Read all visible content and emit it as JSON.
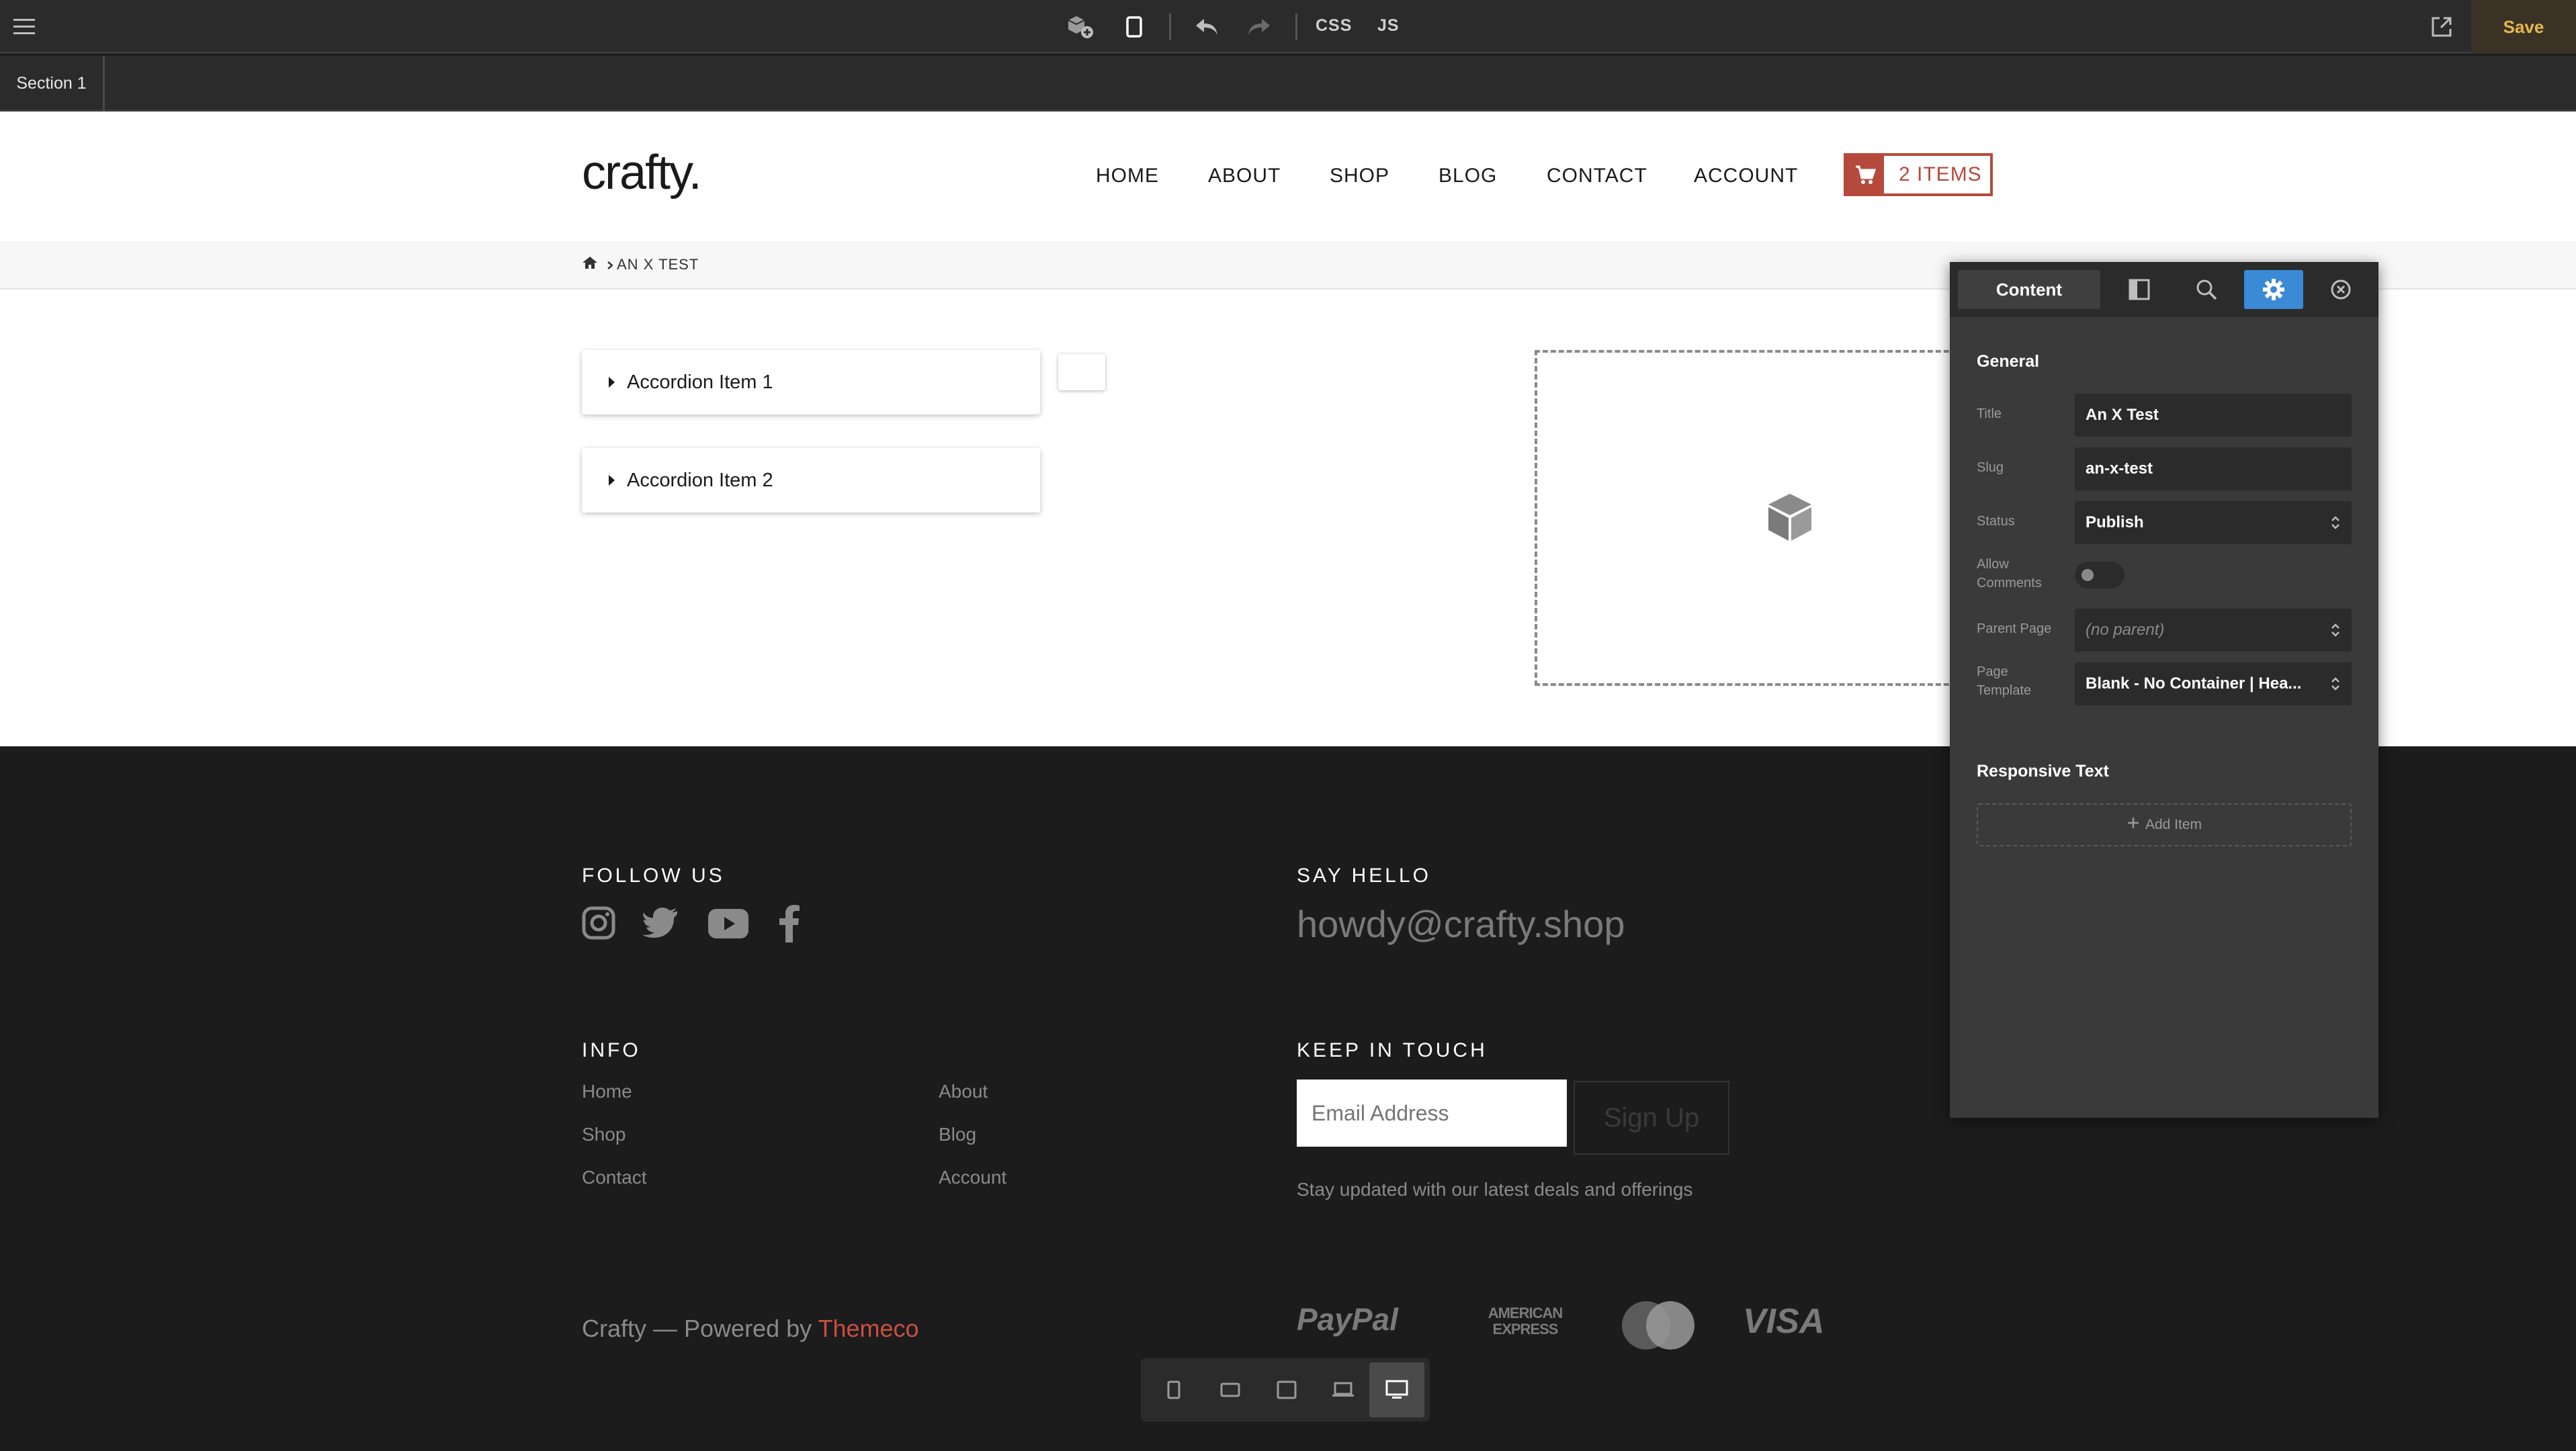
{
  "topbar": {
    "css_label": "CSS",
    "js_label": "JS",
    "save_label": "Save"
  },
  "sectionbar": {
    "section_label": "Section 1"
  },
  "site": {
    "logo": "crafty.",
    "nav": [
      "HOME",
      "ABOUT",
      "SHOP",
      "BLOG",
      "CONTACT",
      "ACCOUNT"
    ],
    "cart_label": "2 ITEMS",
    "breadcrumb": "AN X TEST"
  },
  "content": {
    "accordion": [
      "Accordion Item 1",
      "Accordion Item 2"
    ]
  },
  "footer": {
    "follow_heading": "FOLLOW US",
    "hello_heading": "SAY HELLO",
    "email": "howdy@crafty.shop",
    "info_heading": "INFO",
    "info_links": [
      "Home",
      "About",
      "Shop",
      "Blog",
      "Contact",
      "Account"
    ],
    "keep_heading": "KEEP IN TOUCH",
    "email_placeholder": "Email Address",
    "signup_label": "Sign Up",
    "stay_text": "Stay updated with our latest deals and offerings",
    "powered_prefix": "Crafty — Powered by ",
    "powered_brand": "Themeco",
    "payments": [
      "PayPal",
      "AMERICAN EXPRESS",
      "VISA"
    ]
  },
  "panel": {
    "tab_content": "Content",
    "general_heading": "General",
    "fields": {
      "title_label": "Title",
      "title_value": "An X Test",
      "slug_label": "Slug",
      "slug_value": "an-x-test",
      "status_label": "Status",
      "status_value": "Publish",
      "comments_label_1": "Allow",
      "comments_label_2": "Comments",
      "parent_label": "Parent Page",
      "parent_value": "(no parent)",
      "template_label_1": "Page",
      "template_label_2": "Template",
      "template_value": "Blank - No Container | Hea..."
    },
    "responsive_heading": "Responsive Text",
    "add_item_label": "Add Item"
  },
  "colors": {
    "accent_red": "#b54a3c",
    "panel_active_blue": "#3a8ad6",
    "save_gold": "#e6b94a"
  }
}
